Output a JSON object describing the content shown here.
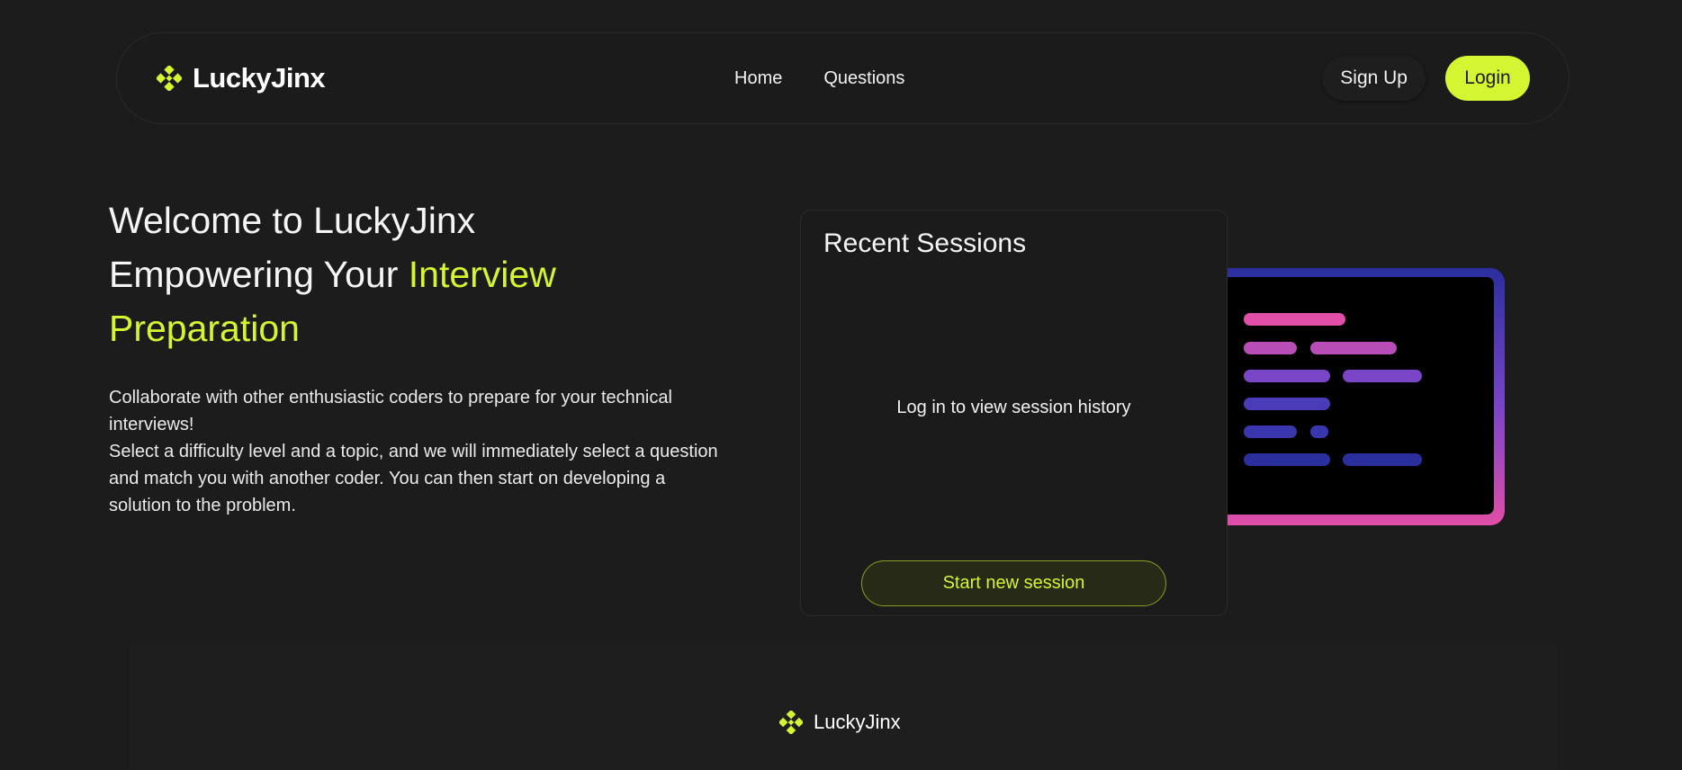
{
  "brand": {
    "name": "LuckyJinx",
    "icon": "diamond-logo-icon"
  },
  "nav": {
    "links": [
      {
        "label": "Home"
      },
      {
        "label": "Questions"
      }
    ],
    "signup_label": "Sign Up",
    "login_label": "Login"
  },
  "hero": {
    "line1": "Welcome to LuckyJinx",
    "line2_prefix": "Empowering Your ",
    "line2_accent": "Interview",
    "line3_accent": "Preparation",
    "description_1": "Collaborate with other enthusiastic coders to prepare for your technical interviews!",
    "description_2": "Select a difficulty level and a topic, and we will immediately select a question and match you with another coder. You can then start on developing a solution to the problem."
  },
  "sessions": {
    "title": "Recent Sessions",
    "empty_message": "Log in to view session history",
    "start_label": "Start new session"
  },
  "illustration": {
    "icon": "code-editor-illustration"
  },
  "footer": {
    "brand": "LuckyJinx"
  },
  "colors": {
    "background": "#1c1c1c",
    "accent": "#d4f531",
    "code_pink": "#e04ea8",
    "code_purple": "#7b45c8",
    "code_blue": "#2b2f9e"
  }
}
